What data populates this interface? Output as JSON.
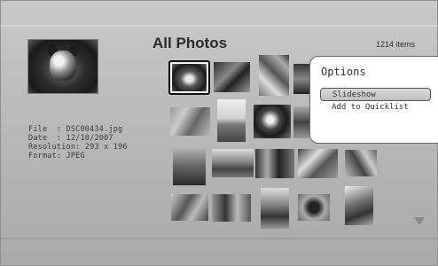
{
  "header": {
    "title": "All Photos",
    "count": "1214 items"
  },
  "preview": {
    "icon": "dog-photo"
  },
  "info": {
    "file": "File  : DSC00434.jpg",
    "date": "Date  : 12/10/2007",
    "resolution": "Resolution: 293 x 196",
    "format": "Format: JPEG"
  },
  "options": {
    "heading": "Options",
    "items": [
      {
        "label": "Slideshow",
        "active": true
      },
      {
        "label": "Add to Quicklist",
        "active": false
      }
    ]
  },
  "colors": {
    "panel": "#ffffff",
    "background": "#bdbdbd",
    "text": "#333333"
  }
}
